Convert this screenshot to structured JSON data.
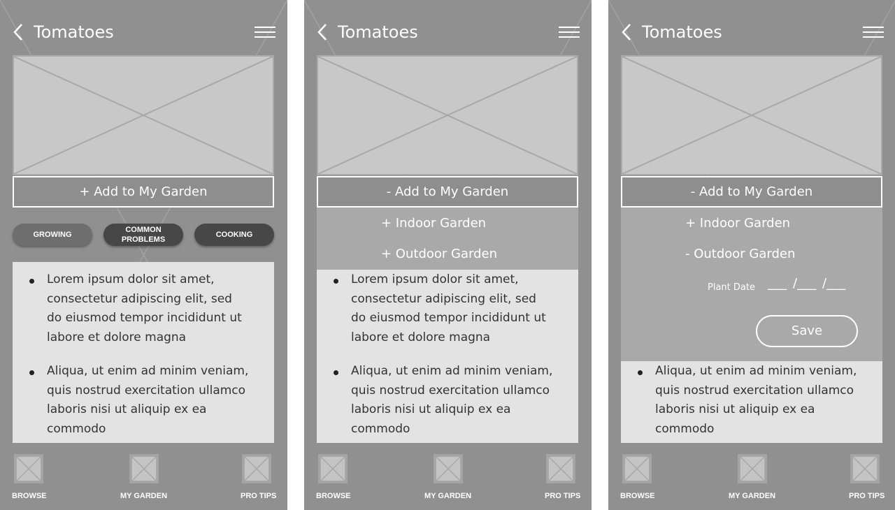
{
  "screens": [
    {
      "header": {
        "title": "Tomatoes"
      },
      "add_button": "+  Add to My Garden",
      "pills": [
        "GROWING",
        "COMMON PROBLEMS",
        "COOKING"
      ],
      "content": [
        "Lorem ipsum dolor sit amet, consectetur adipiscing elit, sed do eiusmod tempor incididunt ut labore et dolore magna",
        "Aliqua, ut enim ad minim veniam, quis nostrud exercitation ullamco laboris nisi ut aliquip ex ea commodo"
      ]
    },
    {
      "header": {
        "title": "Tomatoes"
      },
      "add_button": "-  Add to My Garden",
      "dropdown": [
        "+  Indoor Garden",
        "+  Outdoor Garden"
      ],
      "content": [
        "Lorem ipsum dolor sit amet, consectetur adipiscing elit, sed do eiusmod tempor incididunt ut labore et dolore magna",
        "Aliqua, ut enim ad minim veniam, quis nostrud exercitation ullamco laboris nisi ut aliquip ex ea commodo"
      ]
    },
    {
      "header": {
        "title": "Tomatoes"
      },
      "add_button": "-  Add to My Garden",
      "dropdown": [
        "+  Indoor Garden",
        "-  Outdoor Garden"
      ],
      "plant_date_label": "Plant Date",
      "date_slots": [
        "___",
        "/___",
        "/___"
      ],
      "save_button": "Save",
      "content": [
        "Aliqua, ut enim ad minim veniam, quis nostrud exercitation ullamco laboris nisi ut aliquip ex ea commodo"
      ]
    }
  ],
  "bottom_nav": [
    "BROWSE",
    "MY GARDEN",
    "PRO TIPS"
  ],
  "colors": {
    "screen_bg": "#909090",
    "placeholder": "#c8c8c8",
    "content_bg": "#e3e3e3",
    "dropdown_bg": "#a9a9a9",
    "pill_light": "#6e6e6e",
    "pill_dark": "#474747"
  },
  "icons": {
    "back": "chevron-left-icon",
    "menu": "hamburger-menu-icon",
    "image": "image-placeholder-icon"
  }
}
